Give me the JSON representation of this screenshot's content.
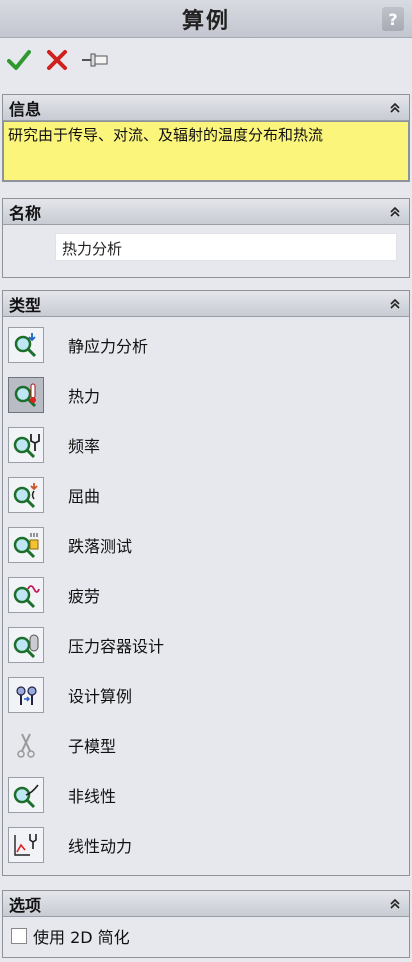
{
  "window": {
    "title": "算例",
    "help": "?"
  },
  "toolbar": {
    "ok": "OK",
    "cancel": "Cancel",
    "pin": "Pin"
  },
  "info": {
    "header": "信息",
    "text": "研究由于传导、对流、及辐射的温度分布和热流"
  },
  "name": {
    "header": "名称",
    "value": "热力分析"
  },
  "type": {
    "header": "类型",
    "items": [
      {
        "label": "静应力分析",
        "icon": "static-analysis-icon"
      },
      {
        "label": "热力",
        "icon": "thermal-icon",
        "selected": true
      },
      {
        "label": "频率",
        "icon": "frequency-icon"
      },
      {
        "label": "屈曲",
        "icon": "buckling-icon"
      },
      {
        "label": "跌落测试",
        "icon": "drop-test-icon"
      },
      {
        "label": "疲劳",
        "icon": "fatigue-icon"
      },
      {
        "label": "压力容器设计",
        "icon": "pressure-vessel-icon"
      },
      {
        "label": "设计算例",
        "icon": "design-study-icon"
      },
      {
        "label": "子模型",
        "icon": "submodel-icon"
      },
      {
        "label": "非线性",
        "icon": "nonlinear-icon"
      },
      {
        "label": "线性动力",
        "icon": "linear-dynamic-icon"
      }
    ]
  },
  "options": {
    "header": "选项",
    "use_2d": "使用 2D 简化",
    "use_2d_checked": false
  },
  "colors": {
    "info_bg": "#fbf57c",
    "ok_green": "#2e9a2e",
    "cancel_red": "#d0201c"
  }
}
